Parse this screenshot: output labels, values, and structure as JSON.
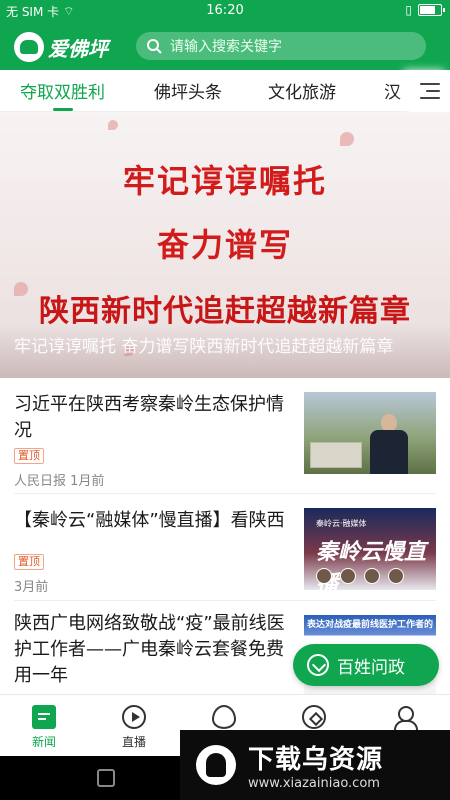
{
  "status_bar": {
    "carrier": "无 SIM 卡",
    "time": "16:20",
    "battery_level": 0.7
  },
  "header": {
    "app_name": "爱佛坪",
    "search_placeholder": "请输入搜索关键字"
  },
  "tabs": [
    {
      "label": "夺取双胜利",
      "active": true
    },
    {
      "label": "佛坪头条",
      "active": false
    },
    {
      "label": "文化旅游",
      "active": false
    },
    {
      "label": "汉",
      "active": false
    }
  ],
  "banner": {
    "line1": "牢记谆谆嘱托",
    "line2": "奋力谱写",
    "line3": "陕西新时代追赶超越新篇章",
    "caption": "牢记谆谆嘱托 奋力谱写陕西新时代追赶超越新篇章"
  },
  "news": [
    {
      "title": "习近平在陕西考察秦岭生态保护情况",
      "tag": "置顶",
      "meta": "人民日报  1月前"
    },
    {
      "title": "【秦岭云“融媒体”慢直播】看陕西",
      "tag": "置顶",
      "meta": "3月前",
      "thumb_title": "秦岭云慢直播",
      "thumb_small": "秦岭云·融媒体"
    },
    {
      "title": "陕西广电网络致敬战“疫”最前线医护工作者——广电秦岭云套餐免费用一年",
      "thumb_title": "表达对战疫最前线医护工作者的"
    }
  ],
  "fab": {
    "label": "百姓问政"
  },
  "bottom_nav": [
    {
      "label": "新闻",
      "icon": "news-icon",
      "active": true
    },
    {
      "label": "直播",
      "icon": "play-icon",
      "active": false
    },
    {
      "label": "",
      "icon": "service-icon",
      "active": false
    },
    {
      "label": "",
      "icon": "compass-icon",
      "active": false
    },
    {
      "label": "",
      "icon": "user-icon",
      "active": false
    }
  ],
  "watermark": {
    "title": "下载乌资源",
    "url": "www.xiazainiao.com"
  },
  "colors": {
    "brand_green": "#10a650",
    "banner_red": "#d21c1c",
    "tag_orange": "#e25a2c"
  }
}
